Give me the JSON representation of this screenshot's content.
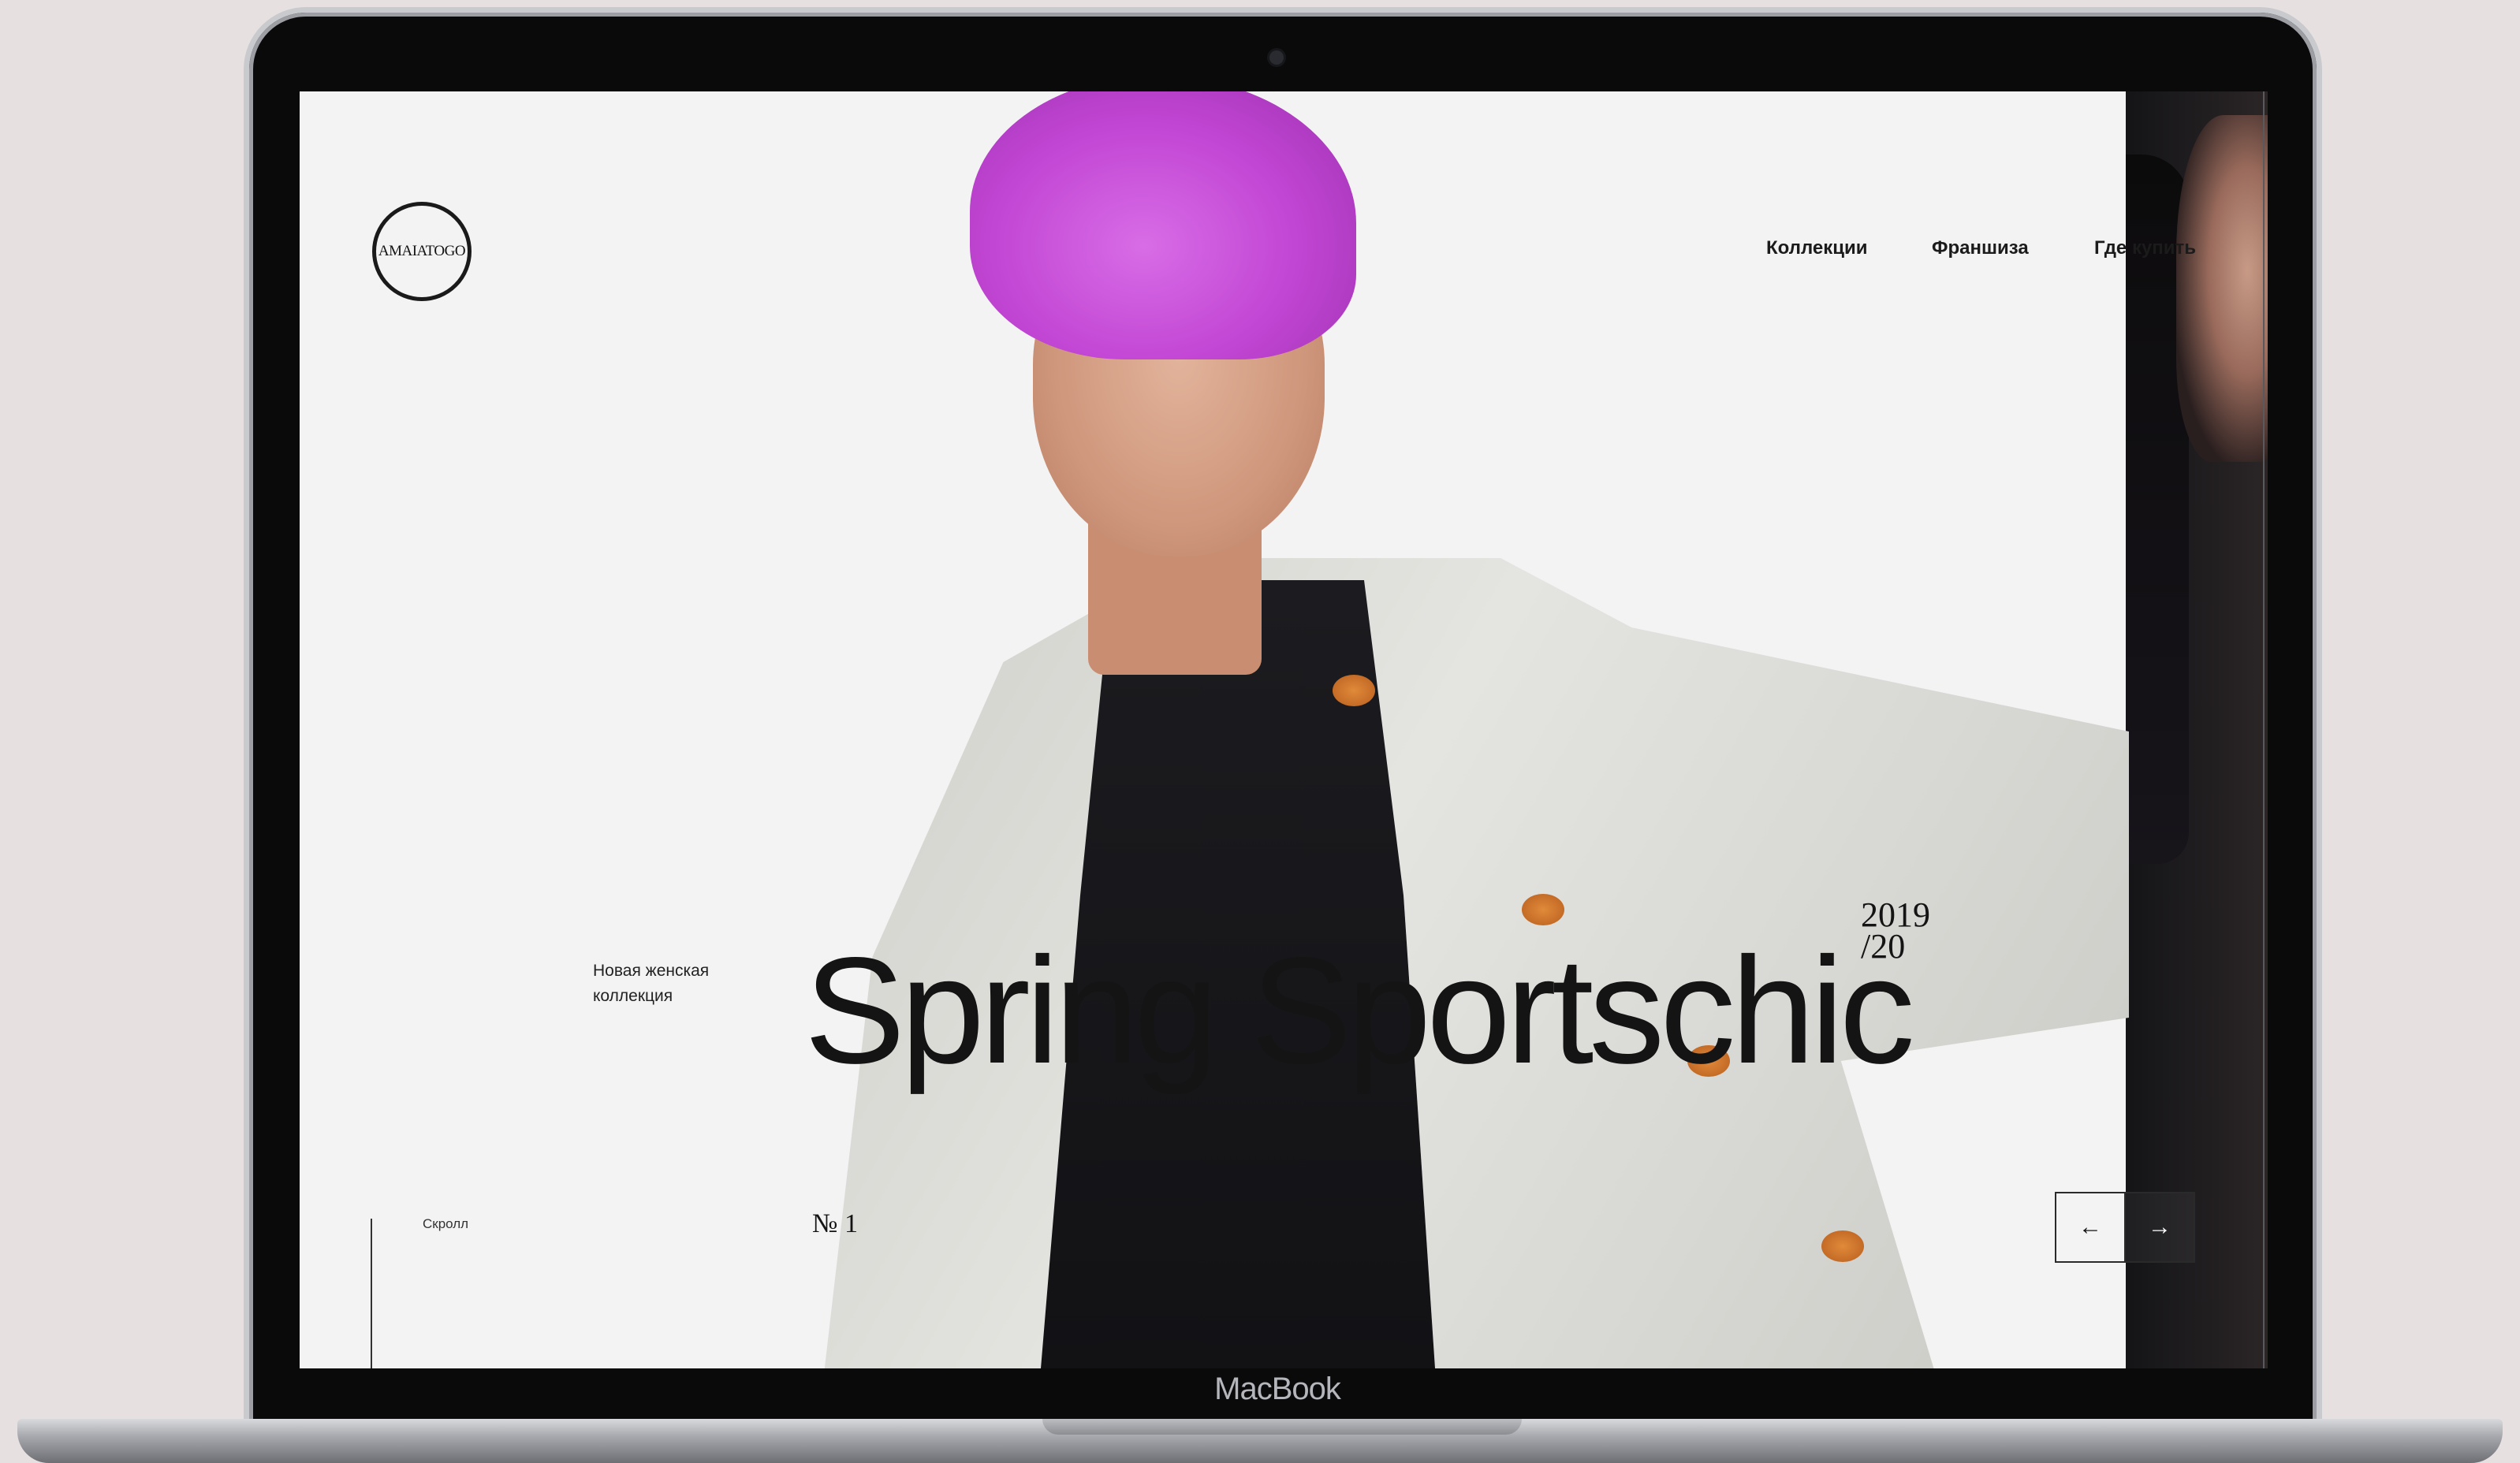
{
  "device": {
    "label": "MacBook"
  },
  "site": {
    "logo_text": "AMAIATOGO",
    "nav": [
      {
        "label": "Коллекции"
      },
      {
        "label": "Франшиза"
      },
      {
        "label": "Где купить"
      }
    ],
    "subtitle_line1": "Новая женская",
    "subtitle_line2": "коллекция",
    "headline": "Spring Sportschic",
    "year_line1": "2019",
    "year_line2": "/20",
    "scroll_label": "Скролл",
    "slide_number": "№ 1",
    "prev_arrow": "←",
    "next_arrow": "→"
  },
  "colors": {
    "accent_hair": "#c246d4",
    "text": "#141414",
    "background": "#f3f3f4"
  }
}
